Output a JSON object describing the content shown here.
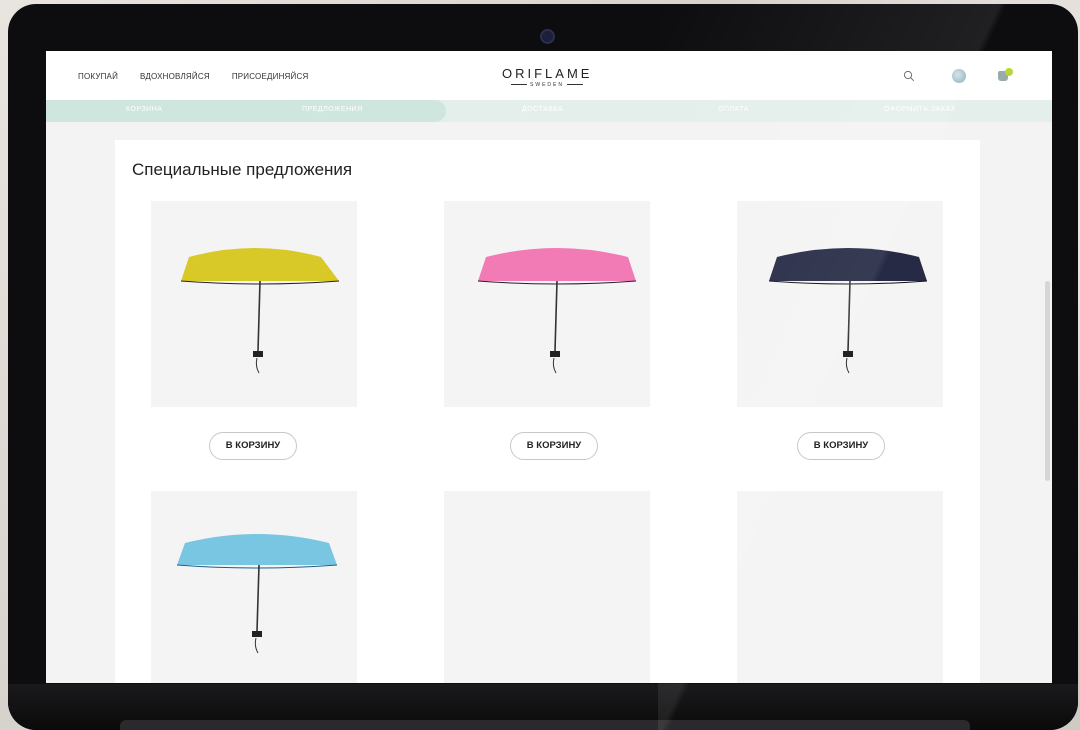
{
  "nav": {
    "shop": "ПОКУПАЙ",
    "inspire": "ВДОХНОВЛЯЙСЯ",
    "join": "ПРИСОЕДИНЯЙСЯ"
  },
  "brand": {
    "name": "ORIFLAME",
    "sub": "SWEDEN"
  },
  "checkout_steps": [
    {
      "label": "КОРЗИНА"
    },
    {
      "label": "ПРЕДЛОЖЕНИЯ"
    },
    {
      "label": "ДОСТАВКА"
    },
    {
      "label": "ОПЛАТА"
    },
    {
      "label": "ОФОРМИТЬ ЗАКАЗ"
    }
  ],
  "offers": {
    "title": "Специальные предложения",
    "products": [
      {
        "color": "#d8c929",
        "button": "В КОРЗИНУ"
      },
      {
        "color": "#f27bb6",
        "button": "В КОРЗИНУ"
      },
      {
        "color": "#262a45",
        "button": "В КОРЗИНУ"
      },
      {
        "color": "#79c6e2"
      }
    ]
  },
  "colors": {
    "accent": "#cfe6df",
    "badge": "#b7d63a"
  }
}
